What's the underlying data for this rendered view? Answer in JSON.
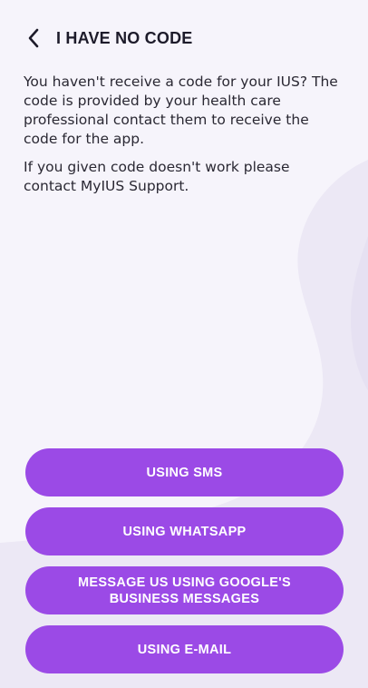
{
  "header": {
    "back_icon": "chevron-left-icon",
    "title": "I HAVE NO CODE"
  },
  "content": {
    "paragraph1": "You haven't receive a code for your IUS? The code is provided by your health care professional contact them to receive the code for the app.",
    "paragraph2": "If you given code doesn't work please contact MyIUS Support."
  },
  "actions": {
    "sms": "USING SMS",
    "whatsapp": "USING WHATSAPP",
    "google_messages": "MESSAGE US USING GOOGLE'S BUSINESS MESSAGES",
    "email": "USING E-MAIL"
  },
  "colors": {
    "background": "#f6f4fb",
    "decorative_shape": "#ece8f5",
    "button": "#9b4ae6",
    "button_text": "#ffffff",
    "text": "#2a2833"
  }
}
